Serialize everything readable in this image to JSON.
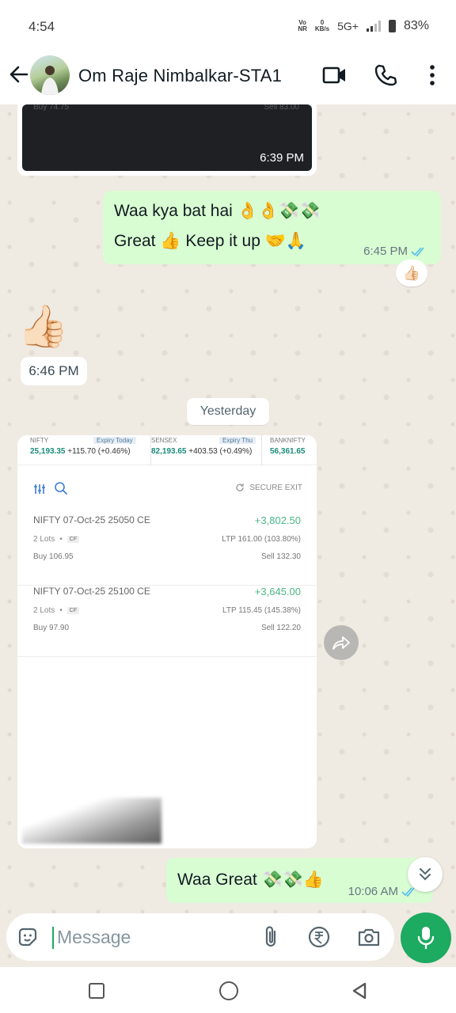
{
  "status_bar": {
    "time": "4:54",
    "volte_top": "Vo",
    "volte_bottom": "NR",
    "speed_top": "0",
    "speed_bottom": "KB/s",
    "network": "5G+",
    "battery": "83%"
  },
  "header": {
    "contact_name": "Om Raje Nimbalkar-STA1"
  },
  "messages": {
    "image_top": {
      "time": "6:39 PM",
      "ghost_left": "Buy 74.75",
      "ghost_right": "Sell 83.00"
    },
    "out_1": {
      "line1": "Waa kya bat hai 👌👌💸💸",
      "line2": "Great 👍 Keep it up 🤝🙏",
      "time": "6:45 PM",
      "reaction": "👍🏻"
    },
    "in_sticker": {
      "emoji": "👍🏻",
      "time": "6:46 PM"
    },
    "date_chip": "Yesterday",
    "image_card": {
      "tickers": [
        {
          "name": "NIFTY",
          "expiry": "Expiry Today",
          "value": "25,193.35",
          "change": "+115.70 (+0.46%)"
        },
        {
          "name": "SENSEX",
          "expiry": "Expiry Thu",
          "value": "82,193.65",
          "change": "+403.53 (+0.49%)"
        },
        {
          "name": "BANKNIFTY",
          "expiry": "",
          "value": "56,361.65",
          "change": ""
        }
      ],
      "secure_exit": "SECURE EXIT",
      "positions": [
        {
          "title": "NIFTY 07-Oct-25 25050 CE",
          "pnl": "+3,802.50",
          "lots": "2 Lots",
          "tag": "CF",
          "ltp": "LTP 161.00 (103.80%)",
          "buy": "Buy 106.95",
          "sell": "Sell 132.30"
        },
        {
          "title": "NIFTY 07-Oct-25 25100 CE",
          "pnl": "+3,645.00",
          "lots": "2 Lots",
          "tag": "CF",
          "ltp": "LTP 115.45 (145.38%)",
          "buy": "Buy 97.90",
          "sell": "Sell 122.20"
        }
      ]
    },
    "out_2": {
      "text": "Waa Great 💸💸👍",
      "time": "10:06 AM"
    }
  },
  "composer": {
    "placeholder": "Message"
  },
  "icons": {
    "accent": "#1daa61",
    "read_ticks": "#53bdeb"
  }
}
